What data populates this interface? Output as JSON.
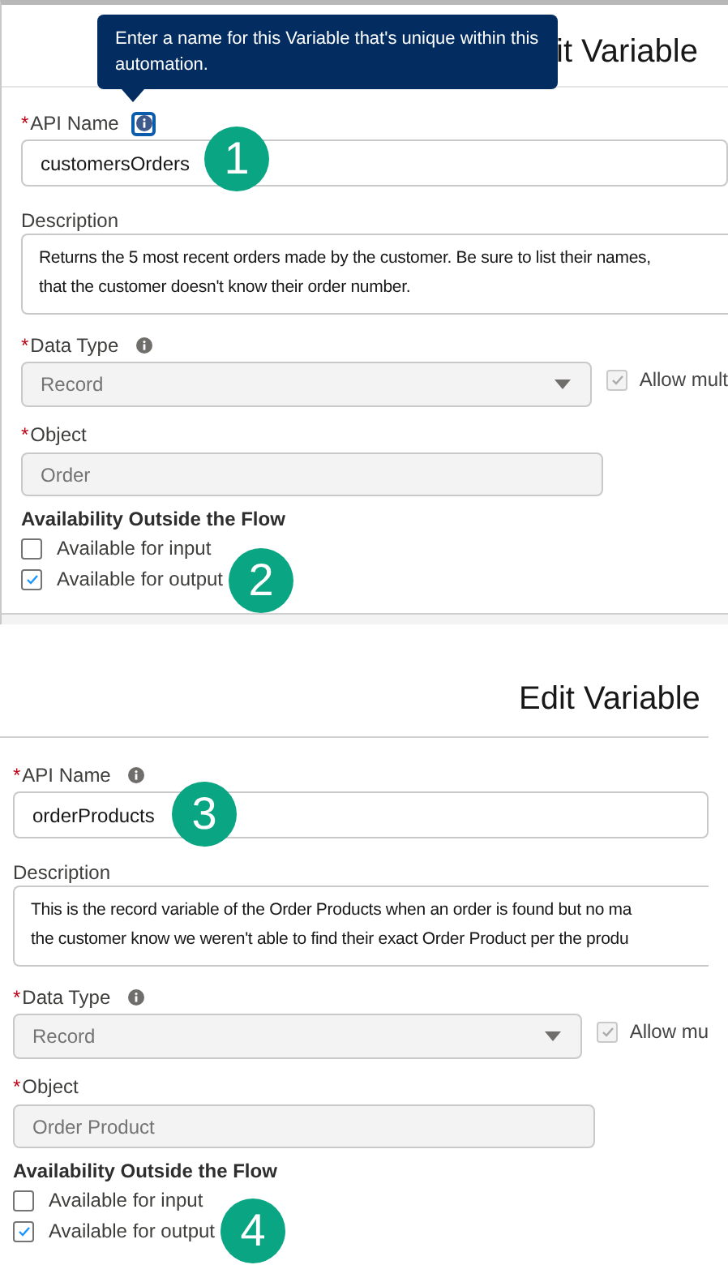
{
  "panels": [
    {
      "title": "it Variable",
      "tooltip": "Enter a name for this Variable that's unique within this automation.",
      "api_name": {
        "required_mark": "*",
        "label": "API Name",
        "info_focused": true,
        "value": "customersOrders",
        "callout": "1"
      },
      "description": {
        "label": "Description",
        "lines": [
          "Returns the 5 most recent orders made by the customer. Be sure to list their names,",
          "that the customer doesn't know their order number."
        ]
      },
      "data_type": {
        "required_mark": "*",
        "label": "Data Type",
        "value": "Record",
        "disabled": true,
        "allow_multiple": {
          "label": "Allow mult",
          "checked": true,
          "disabled": true
        }
      },
      "object": {
        "required_mark": "*",
        "label": "Object",
        "value": "Order",
        "disabled": true
      },
      "availability": {
        "heading": "Availability Outside the Flow",
        "callout": "2",
        "options": [
          {
            "label": "Available for input",
            "checked": false
          },
          {
            "label": "Available for output",
            "checked": true
          }
        ]
      }
    },
    {
      "title": "Edit Variable",
      "api_name": {
        "required_mark": "*",
        "label": "API Name",
        "info_focused": false,
        "value": "orderProducts",
        "callout": "3"
      },
      "description": {
        "label": "Description",
        "lines": [
          "This is the record variable of the Order Products when an order is found but no ma",
          "the customer know we weren't able to find their exact Order Product per the produ"
        ]
      },
      "data_type": {
        "required_mark": "*",
        "label": "Data Type",
        "value": "Record",
        "disabled": true,
        "allow_multiple": {
          "label": "Allow mu",
          "checked": true,
          "disabled": true
        }
      },
      "object": {
        "required_mark": "*",
        "label": "Object",
        "value": "Order Product",
        "disabled": true
      },
      "availability": {
        "heading": "Availability Outside the Flow",
        "callout": "4",
        "options": [
          {
            "label": "Available for input",
            "checked": false
          },
          {
            "label": "Available for output",
            "checked": true
          }
        ]
      }
    }
  ]
}
